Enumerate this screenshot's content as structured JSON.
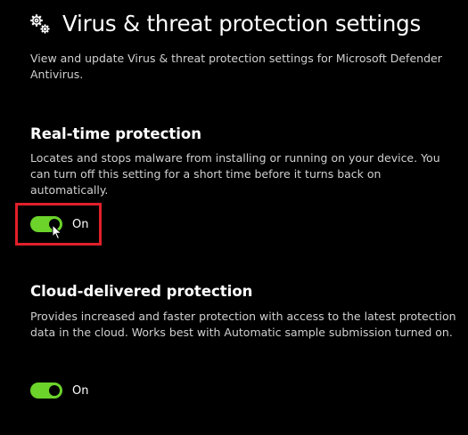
{
  "header": {
    "title": "Virus & threat protection settings",
    "icon": "gears-icon",
    "description": "View and update Virus & threat protection settings for Microsoft Defender Antivirus."
  },
  "realtime": {
    "title": "Real-time protection",
    "description": "Locates and stops malware from installing or running on your device. You can turn off this setting for a short time before it turns back on automatically.",
    "toggle_state": "On",
    "toggle_on": true
  },
  "cloud": {
    "title": "Cloud-delivered protection",
    "description": "Provides increased and faster protection with access to the latest protection data in the cloud. Works best with Automatic sample submission turned on.",
    "toggle_state": "On",
    "toggle_on": true
  },
  "colors": {
    "background": "#000000",
    "toggle_on": "#6bd32a",
    "highlight": "#e0202a",
    "text_secondary": "#d0d0d0"
  }
}
